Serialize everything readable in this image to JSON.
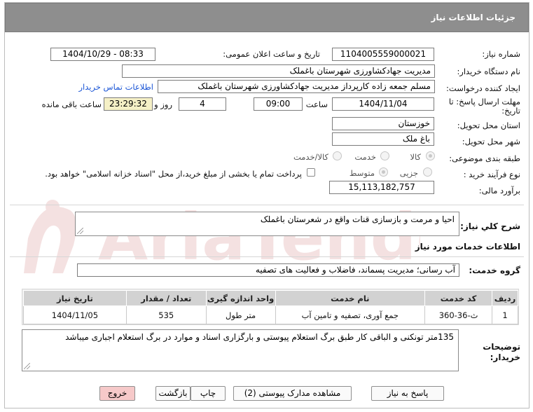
{
  "header": {
    "title": "جزئیات اطلاعات نیاز"
  },
  "fields": {
    "need_number_label": "شماره نیاز:",
    "need_number": "1104005559000021",
    "announce_label": "تاریخ و ساعت اعلان عمومی:",
    "announce_value": "1404/10/29 - 08:33",
    "buyer_org_label": "نام دستگاه خریدار:",
    "buyer_org": "مدیریت جهادکشاورزی شهرستان باغملک",
    "requester_label": "ایجاد کننده درخواست:",
    "requester": "مسلم جمعه زاده کارپرداز مدیریت جهادکشاورزی شهرستان باغملک",
    "buyer_contact_link": "اطلاعات تماس خریدار",
    "deadline_label_1": "مهلت ارسال پاسخ: تا",
    "deadline_label_2": "تاریخ:",
    "deadline_date": "1404/11/04",
    "hour_label": "ساعت",
    "deadline_hour": "09:00",
    "days_value": "4",
    "days_and_label": "روز و",
    "remaining_time": "23:29:32",
    "remaining_label": "ساعت باقی مانده",
    "province_label": "استان محل تحویل:",
    "province": "خوزستان",
    "city_label": "شهر محل تحویل:",
    "city": "باغ ملک",
    "category_label": "طبقه بندی موضوعی:",
    "category_options": [
      "کالا",
      "خدمت",
      "کالا/خدمت"
    ],
    "process_label": "نوع فرآیند خرید :",
    "process_options": [
      "جزیی",
      "متوسط"
    ],
    "payment_note": "پرداخت تمام یا بخشی از مبلغ خرید،از محل \"اسناد خزانه اسلامی\" خواهد بود.",
    "estimate_label": "برآورد مالی:",
    "estimate": "15,113,182,757"
  },
  "description": {
    "label": "شرح کلي نياز:",
    "text": "احیا و مرمت و بازسازی قنات واقع در شعرستان باغملک"
  },
  "services": {
    "section_title": "اطلاعات خدمات مورد نیاز",
    "group_label": "گروه خدمت:",
    "group_value": "آب رسانی؛ مدیریت پسماند، فاضلاب و فعالیت های تصفیه"
  },
  "table": {
    "columns": [
      "ردیف",
      "کد خدمت",
      "نام خدمت",
      "واحد اندازه گیری",
      "تعداد / مقدار",
      "تاریخ نیاز"
    ],
    "rows": [
      [
        "1",
        "ث-36-360",
        "جمع آوری، تصفیه و تامین آب",
        "متر طول",
        "535",
        "1404/11/05"
      ]
    ]
  },
  "buyer_notes": {
    "label_1": "توضیحات",
    "label_2": "خریدار:",
    "text": "135متر تونکنی و الباقی کار طبق برگ استعلام پیوستی و بارگزاری اسناد و موارد در برگ استعلام اجباری میباشد"
  },
  "buttons": {
    "reply": "پاسخ به نیاز",
    "attachments": "مشاهده مدارک پیوستی (2)",
    "print": "چاپ",
    "back": "بازگشت",
    "exit": "خروج"
  },
  "watermark": {
    "text": "AriaTender.neT"
  },
  "colors": {
    "header": "#8e8e8e",
    "link": "#1a55d6",
    "remaining_bg": "#f5f0c6",
    "exit_bg": "#f6c9c9"
  }
}
